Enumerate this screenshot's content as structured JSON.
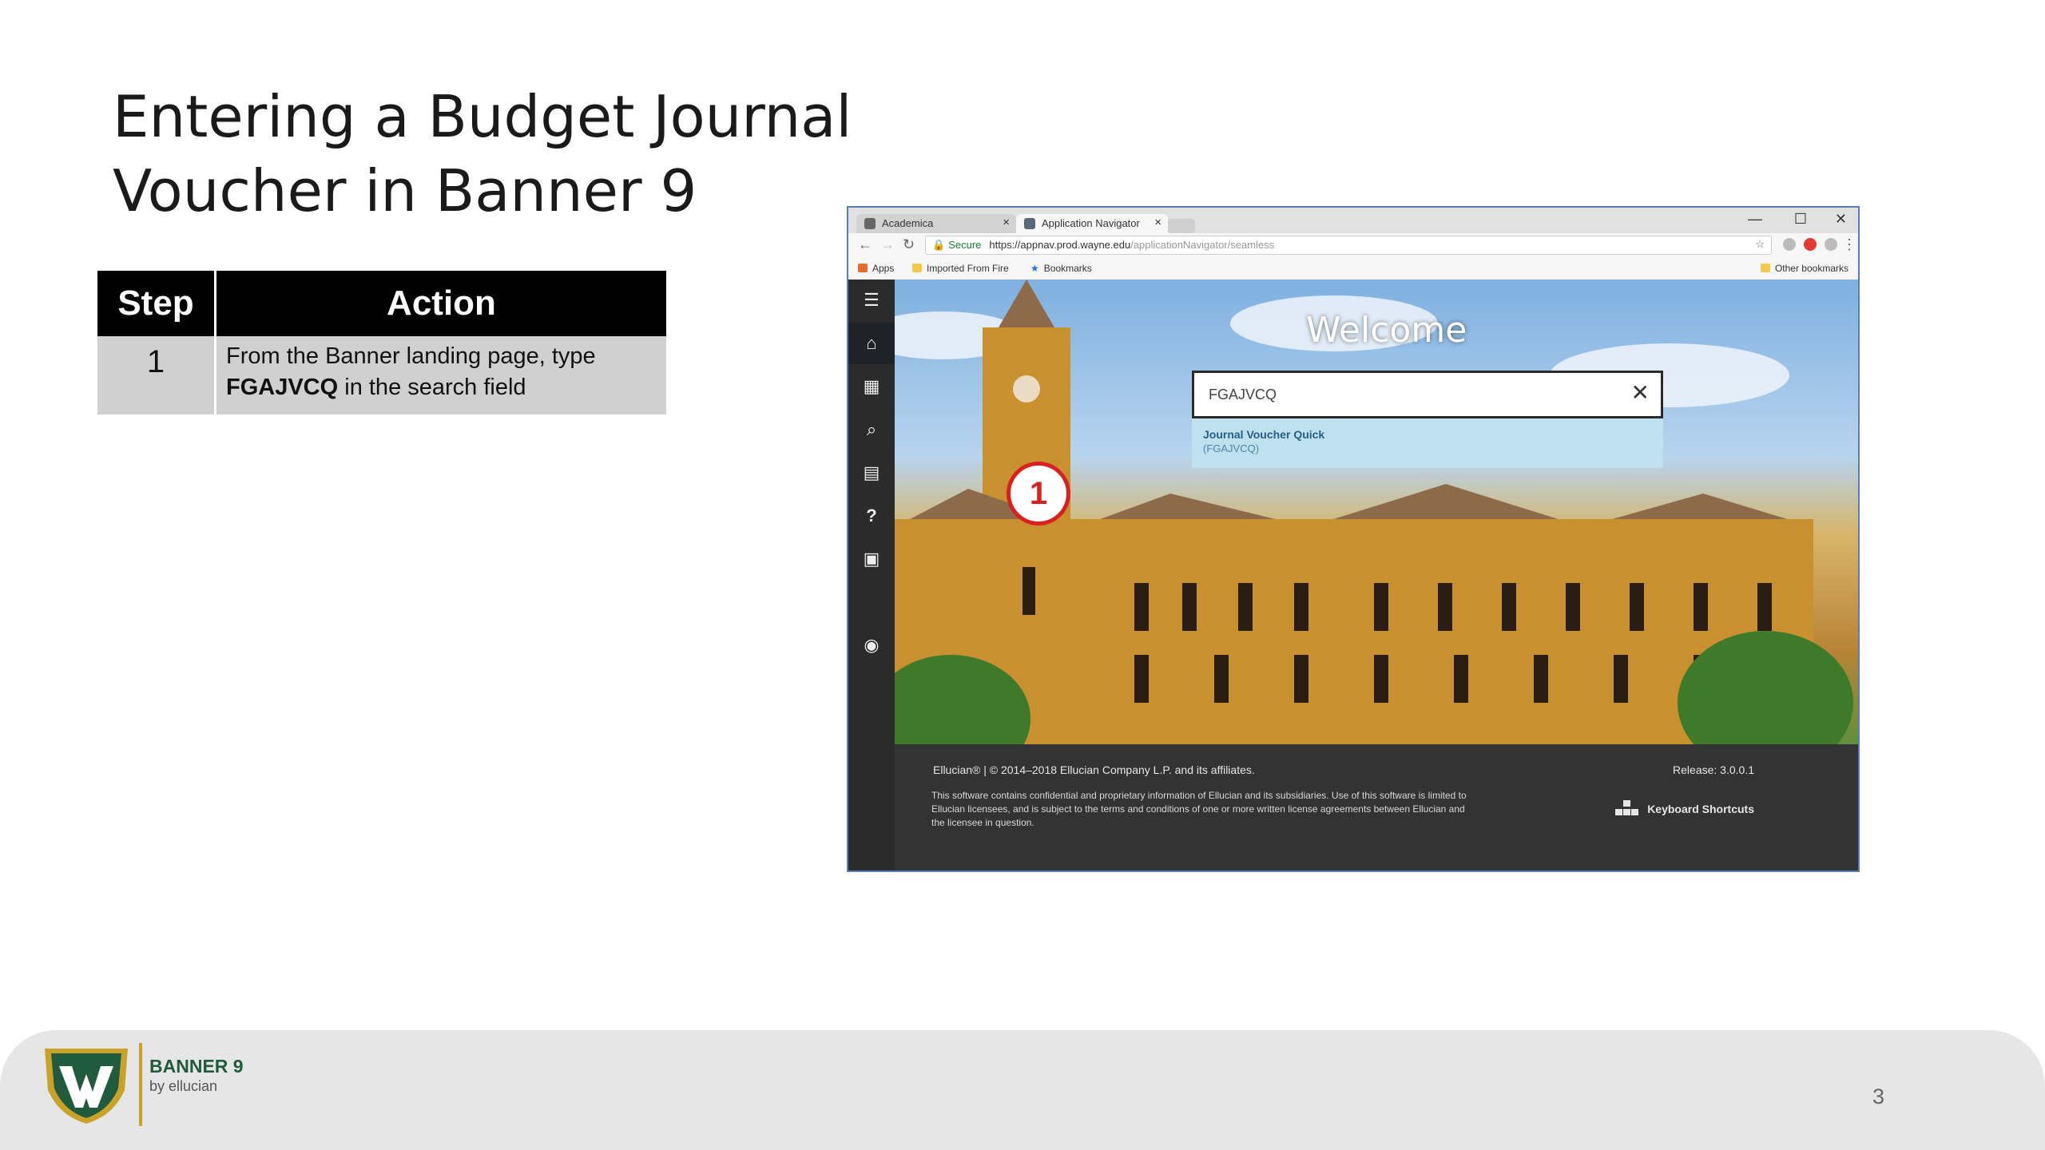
{
  "slide": {
    "title_line1": "Entering a Budget Journal",
    "title_line2": "Voucher in Banner 9",
    "page_number": "3"
  },
  "table": {
    "headers": {
      "step": "Step",
      "action": "Action"
    },
    "rows": [
      {
        "step": "1",
        "action_text": "From the Banner landing page, type",
        "action_code": "FGAJVCQ",
        "action_suffix": "in the search field"
      }
    ]
  },
  "screenshot": {
    "tabs": [
      {
        "label": "Academica",
        "active": false
      },
      {
        "label": "Application Navigator",
        "active": true
      }
    ],
    "tab_close_glyph": "×",
    "window_controls": [
      "—",
      "☐",
      "✕"
    ],
    "url_secure_label": "Secure",
    "url_main": "https://appnav.prod.wayne.edu",
    "url_rest": "/applicationNavigator/seamless",
    "bookmarks": {
      "apps": "Apps",
      "imported": "Imported From Fire",
      "bookmarks": "Bookmarks",
      "other": "Other bookmarks"
    },
    "welcome_text": "Welcome",
    "search_value": "FGAJVCQ",
    "search_clear_glyph": "✕",
    "suggestion_title": "Journal Voucher Quick",
    "suggestion_code": "(FGAJVCQ)",
    "callout_number": "1",
    "footer": {
      "copyright": "Ellucian® | © 2014–2018 Ellucian Company L.P. and its affiliates.",
      "release": "Release: 3.0.0.1",
      "legal": "This software contains confidential and proprietary information of Ellucian and its subsidiaries. Use of this software is limited to Ellucian licensees, and is subject to the terms and conditions of one or more written license agreements between Ellucian and the licensee in question.",
      "keyboard_shortcuts": "Keyboard Shortcuts"
    },
    "sidebar_icons": [
      "menu-icon",
      "home-icon",
      "apps-grid-icon",
      "search-icon",
      "recent-items-icon",
      "help-icon",
      "lock-icon",
      "user-icon"
    ]
  },
  "logo": {
    "product": "BANNER 9",
    "vendor": "by ellucian"
  },
  "colors": {
    "callout_red": "#d8201f",
    "table_header": "#000000",
    "table_row": "#d0d0d0",
    "footer_band": "#e6e6e6",
    "wayne_green": "#1f5b3c",
    "wayne_gold": "#c9a227"
  }
}
